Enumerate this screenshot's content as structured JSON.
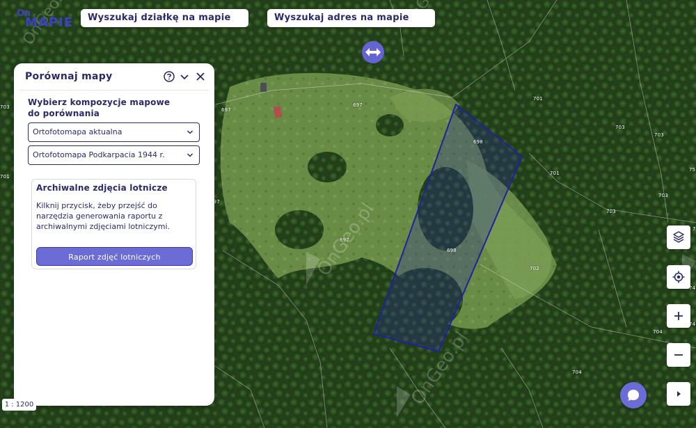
{
  "app": {
    "logo_text_top": "On",
    "logo_text": "MAPIE"
  },
  "search": {
    "parcel_label": "Wyszukaj działkę na mapie",
    "address_label": "Wyszukaj adres na mapie"
  },
  "panel": {
    "title": "Porównaj mapy",
    "select_label": "Wybierz kompozycje mapowe do porównania",
    "select_1_value": "Ortofotomapa aktualna",
    "select_2_value": "Ortofotomapa Podkarpacia 1944 r.",
    "archive": {
      "title": "Archiwalne zdjęcia lotnicze",
      "description": "Kilknij przycisk, żeby przejść do narzędzia generowania raportu z archiwalnymi zdjęciami lotniczymi.",
      "button_label": "Raport zdjęć lotniczych"
    }
  },
  "map": {
    "scale_label": "1 : 1200",
    "watermark": "OnGeo.pl",
    "parcel_numbers": [
      "697",
      "697",
      "697",
      "697",
      "698",
      "698",
      "701",
      "701",
      "701",
      "702",
      "703",
      "703",
      "703",
      "703",
      "703",
      "704",
      "704",
      "75",
      "74",
      "74",
      "7"
    ],
    "selected_parcel_color": "#2020a0"
  },
  "toolbar": {
    "icons": [
      "layers-icon",
      "locate-icon",
      "zoom-in-icon",
      "zoom-out-icon",
      "expand-icon"
    ]
  },
  "colors": {
    "accent": "#6c6cd6",
    "text": "#2a2a6a"
  }
}
